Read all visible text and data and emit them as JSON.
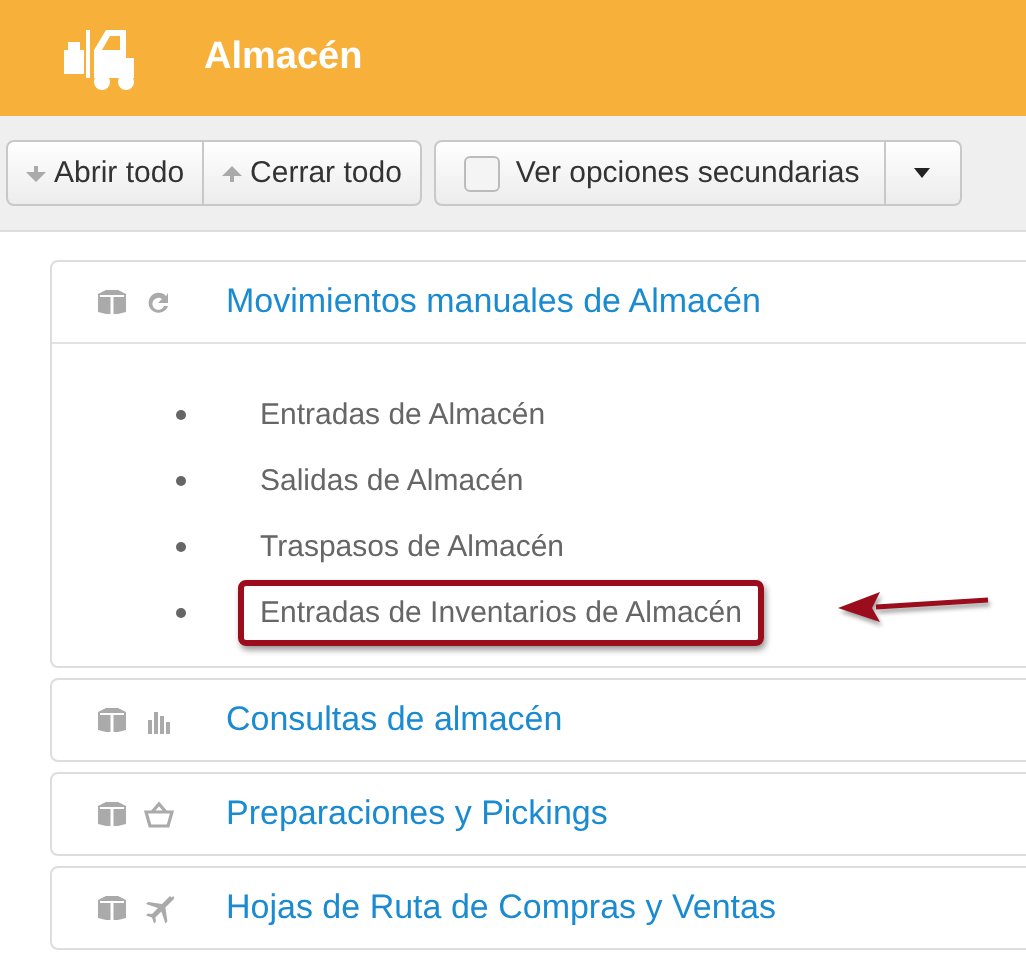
{
  "header": {
    "title": "Almacén"
  },
  "toolbar": {
    "buttons": [
      {
        "label": "Abrir todo",
        "kind": "expand"
      },
      {
        "label": "Cerrar todo",
        "kind": "collapse"
      }
    ],
    "option": {
      "label": "Ver opciones secundarias",
      "checked": false
    }
  },
  "sections": [
    {
      "title": "Movimientos manuales de Almacén",
      "kind": "refresh",
      "expanded": true,
      "items": [
        {
          "label": "Entradas de Almacén",
          "highlighted": false
        },
        {
          "label": "Salidas de Almacén",
          "highlighted": false
        },
        {
          "label": "Traspasos de Almacén",
          "highlighted": false
        },
        {
          "label": "Entradas de Inventarios de Almacén",
          "highlighted": true
        }
      ]
    },
    {
      "title": "Consultas de almacén",
      "kind": "chart",
      "expanded": false
    },
    {
      "title": "Preparaciones y Pickings",
      "kind": "basket",
      "expanded": false
    },
    {
      "title": "Hojas de Ruta de Compras y Ventas",
      "kind": "plane",
      "expanded": false
    }
  ]
}
